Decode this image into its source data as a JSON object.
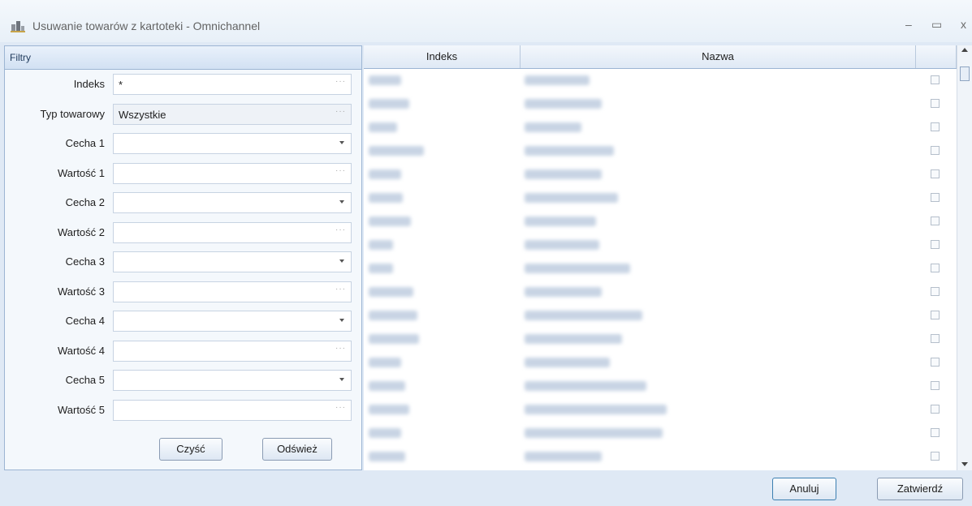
{
  "window": {
    "title": "Usuwanie towarów z kartoteki - Omnichannel",
    "controls": {
      "minimize": "–",
      "maximize": "▭",
      "close": "x"
    }
  },
  "filters": {
    "header": "Filtry",
    "rows": [
      {
        "label": "Indeks",
        "value": "*",
        "kind": "dots"
      },
      {
        "label": "Typ towarowy",
        "value": "Wszystkie",
        "kind": "dots-ro"
      },
      {
        "label": "Cecha 1",
        "value": "",
        "kind": "select"
      },
      {
        "label": "Wartość 1",
        "value": "",
        "kind": "dots"
      },
      {
        "label": "Cecha 2",
        "value": "",
        "kind": "select"
      },
      {
        "label": "Wartość 2",
        "value": "",
        "kind": "dots"
      },
      {
        "label": "Cecha 3",
        "value": "",
        "kind": "select"
      },
      {
        "label": "Wartość 3",
        "value": "",
        "kind": "dots"
      },
      {
        "label": "Cecha 4",
        "value": "",
        "kind": "select"
      },
      {
        "label": "Wartość 4",
        "value": "",
        "kind": "dots"
      },
      {
        "label": "Cecha 5",
        "value": "",
        "kind": "select"
      },
      {
        "label": "Wartość 5",
        "value": "",
        "kind": "dots"
      }
    ],
    "clear_label": "Czyść",
    "refresh_label": "Odśwież"
  },
  "grid": {
    "columns": [
      "Indeks",
      "Nazwa",
      ""
    ],
    "row_count_visible": 17
  },
  "footer": {
    "cancel_label": "Anuluj",
    "confirm_label": "Zatwierdź"
  }
}
